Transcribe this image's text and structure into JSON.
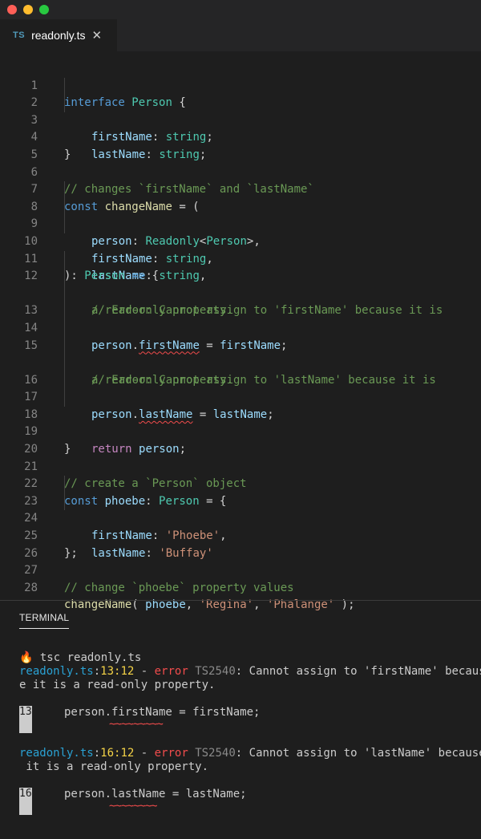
{
  "tab": {
    "lang_badge": "TS",
    "filename": "readonly.ts",
    "close_glyph": "✕"
  },
  "editor": {
    "line_numbers": [
      "1",
      "2",
      "3",
      "4",
      "5",
      "6",
      "7",
      "8",
      "9",
      "10",
      "11",
      "12",
      "",
      "13",
      "14",
      "15",
      "",
      "16",
      "17",
      "18",
      "19",
      "20",
      "21",
      "22",
      "23",
      "24",
      "25",
      "26",
      "27",
      "28"
    ]
  },
  "code": {
    "l1": [
      "interface",
      "Person",
      "{"
    ],
    "l2": [
      "firstName",
      ":",
      "string",
      ";"
    ],
    "l3": [
      "lastName",
      ":",
      "string",
      ";"
    ],
    "l4": [
      "}"
    ],
    "l6": [
      "// changes `firstName` and `lastName`"
    ],
    "l7": [
      "const",
      "changeName",
      "= ("
    ],
    "l8": [
      "person",
      ":",
      "Readonly",
      "<",
      "Person",
      ">,"
    ],
    "l9": [
      "firstName",
      ":",
      "string",
      ","
    ],
    "l10": [
      "lastName",
      ":",
      "string",
      ","
    ],
    "l11": [
      "):",
      "Person",
      "=>",
      "{"
    ],
    "l12a": [
      "// Error: Cannot assign to 'firstName' because it is"
    ],
    "l12b": [
      "a read-only property."
    ],
    "l13": [
      "person",
      ".",
      "firstName",
      " = ",
      "firstName",
      ";"
    ],
    "l15a": [
      "// Error: Cannot assign to 'lastName' because it is"
    ],
    "l15b": [
      "a read-only property."
    ],
    "l16": [
      "person",
      ".",
      "lastName",
      " = ",
      "lastName",
      ";"
    ],
    "l18": [
      "return",
      "person",
      ";"
    ],
    "l19": [
      "}"
    ],
    "l21": [
      "// create a `Person` object"
    ],
    "l22": [
      "const",
      "phoebe",
      ":",
      "Person",
      "= {"
    ],
    "l23": [
      "firstName",
      ":",
      "'Phoebe'",
      ","
    ],
    "l24": [
      "lastName",
      ":",
      "'Buffay'"
    ],
    "l25": [
      "};"
    ],
    "l27": [
      "// change `phoebe` property values"
    ],
    "l28": [
      "changeName",
      "(",
      "phoebe",
      ",",
      "'Regina'",
      ",",
      "'Phalange'",
      ");"
    ]
  },
  "panel": {
    "tab_label": "TERMINAL"
  },
  "terminal": {
    "prompt_icon": "🔥",
    "command": "tsc readonly.ts",
    "error1": {
      "file": "readonly.ts",
      "sep": ":",
      "loc": "13:12",
      "dash": " - ",
      "level": "error",
      "code": "TS2540",
      "message_a": ": Cannot assign to 'firstName' becaus",
      "message_b": "e it is a read-only property.",
      "gutter": "13",
      "snippet": "person.firstName = firstName;",
      "underline": "~~~~~~~~~"
    },
    "error2": {
      "file": "readonly.ts",
      "sep": ":",
      "loc": "16:12",
      "dash": " - ",
      "level": "error",
      "code": "TS2540",
      "message_a": ": Cannot assign to 'lastName' because",
      "message_b": " it is a read-only property.",
      "gutter": "16",
      "snippet": "person.lastName = lastName;",
      "underline": "~~~~~~~~"
    }
  },
  "colors": {
    "background": "#1e1e1e",
    "keyword": "#569cd6",
    "type": "#4ec9b0",
    "property": "#9cdcfe",
    "function": "#dcdcaa",
    "comment": "#6a9955",
    "string": "#ce9178",
    "error": "#f14c4c",
    "terminal_file": "#2aa1d3",
    "terminal_loc": "#f5d347"
  }
}
